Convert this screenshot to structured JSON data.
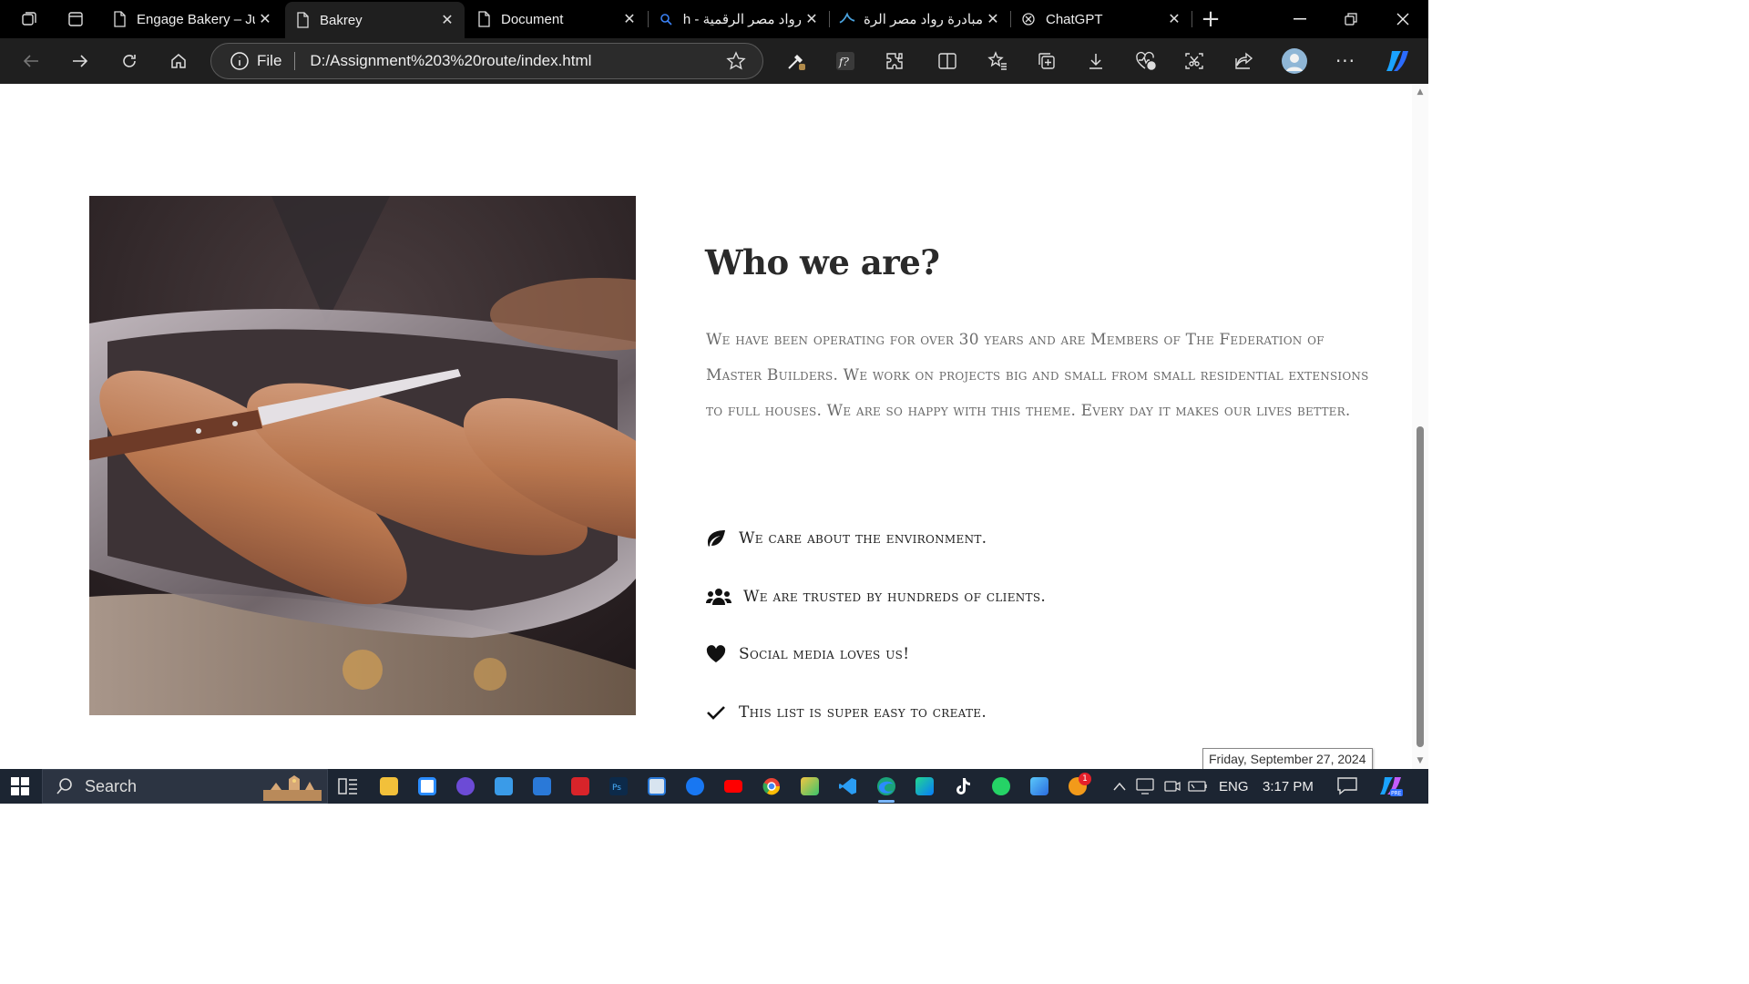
{
  "browser": {
    "tabs": [
      {
        "title": "Engage Bakery – Ju",
        "icon": "page-icon",
        "active": false
      },
      {
        "title": "Bakrey",
        "icon": "page-icon",
        "active": true
      },
      {
        "title": "Document",
        "icon": "page-icon",
        "active": false
      },
      {
        "title": "رواد مصر الرقمية - h",
        "icon": "search-icon",
        "active": false
      },
      {
        "title": "مبادرة رواد مصر الرة",
        "icon": "site-logo-icon",
        "active": false
      },
      {
        "title": "ChatGPT",
        "icon": "chatgpt-icon",
        "active": false
      }
    ],
    "address": {
      "scheme_label": "File",
      "url": "D:/Assignment%203%20route/index.html"
    }
  },
  "page": {
    "heading": "Who we are?",
    "paragraph": "We have been operating for over 30 years and are Members of The Federation of Master Builders. We work on projects big and small from small residential extensions to full houses. We are so happy with this theme. Every day it makes our lives better.",
    "features": [
      {
        "text": "We care about the environment.",
        "icon": "leaf-icon"
      },
      {
        "text": "We are trusted by hundreds of clients.",
        "icon": "users-icon"
      },
      {
        "text": "Social media loves us!",
        "icon": "heart-icon"
      },
      {
        "text": "This list is super easy to create.",
        "icon": "check-icon"
      }
    ],
    "image_subject": "pastry-tray-photo"
  },
  "tooltip": "Friday, September 27, 2024",
  "taskbar": {
    "search_label": "Search",
    "language": "ENG",
    "time": "3:17 PM",
    "notification_badge": "1"
  },
  "colors": {
    "chrome_bg": "#000000",
    "toolbar_bg": "#1f1f1f",
    "taskbar_bg": "#1c2532",
    "heading": "#2a2a2a",
    "paragraph": "#6b6b6b"
  }
}
